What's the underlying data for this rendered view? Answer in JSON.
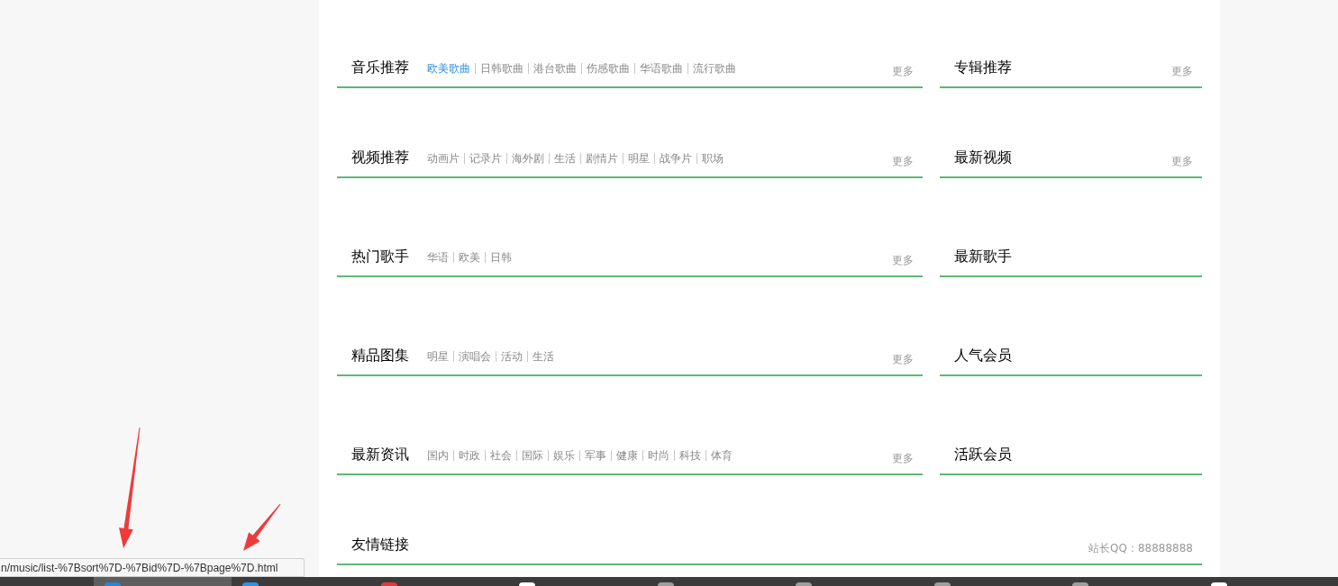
{
  "rows": [
    {
      "main": {
        "title": "音乐推荐",
        "links": [
          {
            "label": "欧美歌曲",
            "hovered": true
          },
          {
            "label": "日韩歌曲",
            "hovered": false
          },
          {
            "label": "港台歌曲",
            "hovered": false
          },
          {
            "label": "伤感歌曲",
            "hovered": false
          },
          {
            "label": "华语歌曲",
            "hovered": false
          },
          {
            "label": "流行歌曲",
            "hovered": false
          }
        ],
        "more": "更多"
      },
      "side": {
        "title": "专辑推荐",
        "more": "更多"
      }
    },
    {
      "main": {
        "title": "视频推荐",
        "links": [
          {
            "label": "动画片",
            "hovered": false
          },
          {
            "label": "记录片",
            "hovered": false
          },
          {
            "label": "海外剧",
            "hovered": false
          },
          {
            "label": "生活",
            "hovered": false
          },
          {
            "label": "剧情片",
            "hovered": false
          },
          {
            "label": "明星",
            "hovered": false
          },
          {
            "label": "战争片",
            "hovered": false
          },
          {
            "label": "职场",
            "hovered": false
          }
        ],
        "more": "更多"
      },
      "side": {
        "title": "最新视频",
        "more": "更多"
      }
    },
    {
      "main": {
        "title": "热门歌手",
        "links": [
          {
            "label": "华语",
            "hovered": false
          },
          {
            "label": "欧美",
            "hovered": false
          },
          {
            "label": "日韩",
            "hovered": false
          }
        ],
        "more": "更多"
      },
      "side": {
        "title": "最新歌手"
      }
    },
    {
      "main": {
        "title": "精品图集",
        "links": [
          {
            "label": "明星",
            "hovered": false
          },
          {
            "label": "演唱会",
            "hovered": false
          },
          {
            "label": "活动",
            "hovered": false
          },
          {
            "label": "生活",
            "hovered": false
          }
        ],
        "more": "更多"
      },
      "side": {
        "title": "人气会员"
      }
    },
    {
      "main": {
        "title": "最新资讯",
        "links": [
          {
            "label": "国内",
            "hovered": false
          },
          {
            "label": "时政",
            "hovered": false
          },
          {
            "label": "社会",
            "hovered": false
          },
          {
            "label": "国际",
            "hovered": false
          },
          {
            "label": "娱乐",
            "hovered": false
          },
          {
            "label": "军事",
            "hovered": false
          },
          {
            "label": "健康",
            "hovered": false
          },
          {
            "label": "时尚",
            "hovered": false
          },
          {
            "label": "科技",
            "hovered": false
          },
          {
            "label": "体育",
            "hovered": false
          }
        ],
        "more": "更多"
      },
      "side": {
        "title": "活跃会员"
      }
    }
  ],
  "footer": {
    "title": "友情链接",
    "contact": "站长QQ：88888888"
  },
  "status_bar": {
    "url": "n/music/list-%7Bsort%7D-%7Bid%7D-%7Bpage%7D.html"
  },
  "taskbar": {
    "buttons": [
      {
        "selected": true,
        "color": "#1e88e5"
      },
      {
        "selected": false,
        "color": "#2196f3"
      },
      {
        "selected": false,
        "color": "#e53935"
      },
      {
        "selected": false,
        "color": "#ffffff"
      },
      {
        "selected": false,
        "color": "#9e9e9e"
      },
      {
        "selected": false,
        "color": "#9e9e9e"
      },
      {
        "selected": false,
        "color": "#9e9e9e"
      },
      {
        "selected": false,
        "color": "#9e9e9e"
      },
      {
        "selected": false,
        "color": "#ffffff"
      }
    ]
  }
}
